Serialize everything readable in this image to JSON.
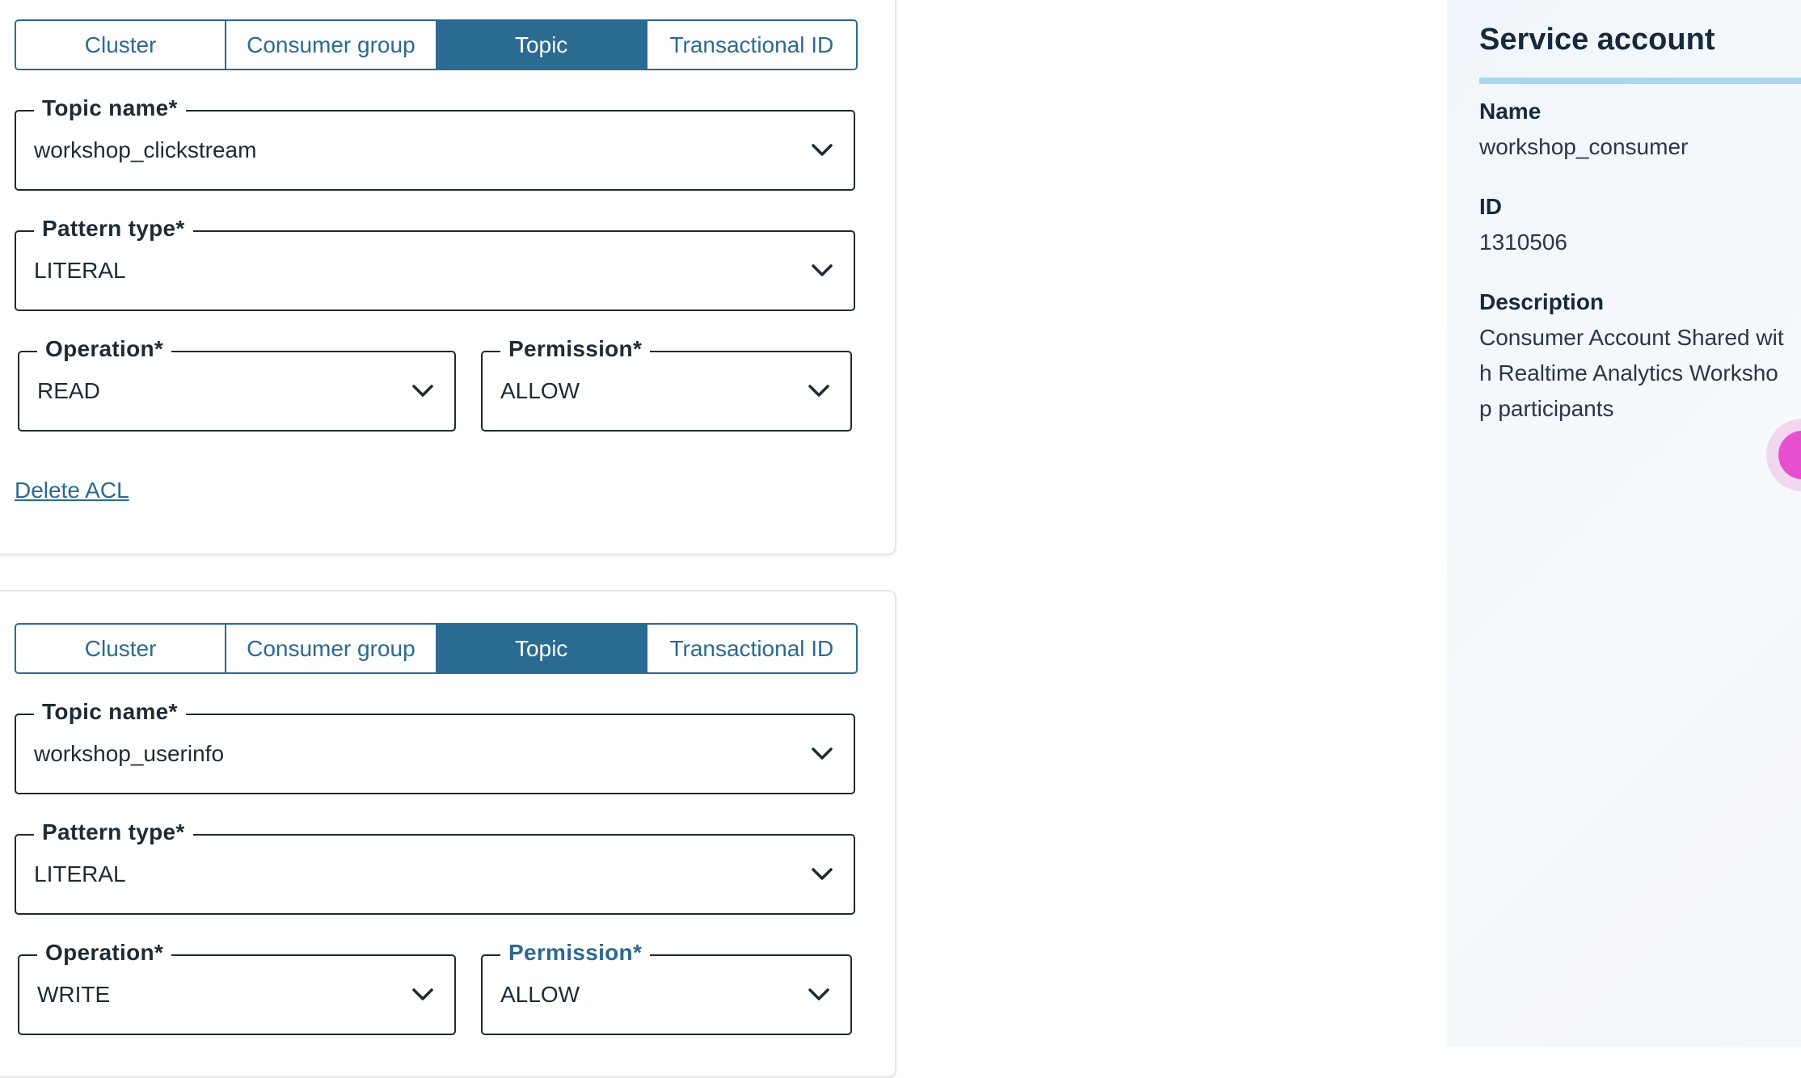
{
  "acl_entries": [
    {
      "tabs": [
        "Cluster",
        "Consumer group",
        "Topic",
        "Transactional ID"
      ],
      "active_tab": "Topic",
      "topic_name": {
        "label": "Topic name*",
        "value": "workshop_clickstream"
      },
      "pattern_type": {
        "label": "Pattern type*",
        "value": "LITERAL"
      },
      "operation": {
        "label": "Operation*",
        "value": "READ"
      },
      "permission": {
        "label": "Permission*",
        "value": "ALLOW"
      },
      "delete_label": "Delete ACL"
    },
    {
      "tabs": [
        "Cluster",
        "Consumer group",
        "Topic",
        "Transactional ID"
      ],
      "active_tab": "Topic",
      "topic_name": {
        "label": "Topic name*",
        "value": "workshop_userinfo"
      },
      "pattern_type": {
        "label": "Pattern type*",
        "value": "LITERAL"
      },
      "operation": {
        "label": "Operation*",
        "value": "WRITE"
      },
      "permission": {
        "label": "Permission*",
        "value": "ALLOW"
      }
    }
  ],
  "service_account": {
    "title": "Service account",
    "name_label": "Name",
    "name_value": "workshop_consumer",
    "id_label": "ID",
    "id_value": "1310506",
    "description_label": "Description",
    "description_value": "Consumer Account Shared with Realtime Analytics Workshop participants"
  },
  "colors": {
    "accent": "#2b6a91",
    "panel_bg": "#f0f6fb",
    "title_underline": "#a8d8ee",
    "help_bubble": "#e650cf"
  },
  "icons": [
    "chevron-down-icon",
    "help-bubble-icon"
  ]
}
